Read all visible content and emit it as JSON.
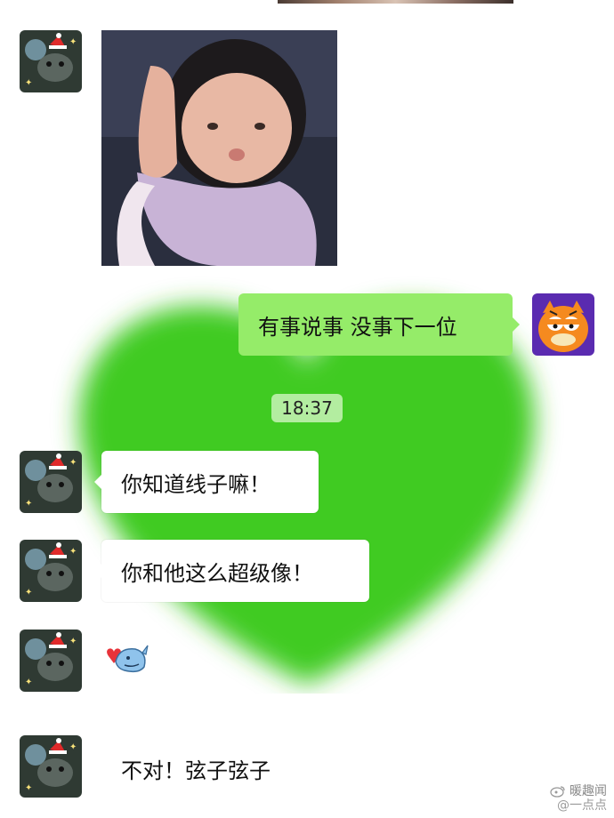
{
  "chat": {
    "outgoing_message": "有事说事 没事下一位",
    "timestamp": "18:37",
    "messages": [
      "你知道线子嘛！",
      "你和他这么超级像！",
      "不对！弦子弦子"
    ]
  },
  "watermark": {
    "line1": "暖趣闻",
    "line2": "@一点点"
  },
  "colors": {
    "outgoing_bubble": "#95ec69",
    "incoming_bubble": "#ffffff",
    "heart_background": "#3fcb22"
  },
  "icons": [
    "cat-avatar-icon",
    "garfield-avatar-icon",
    "whale-heart-sticker-icon",
    "weibo-icon"
  ]
}
